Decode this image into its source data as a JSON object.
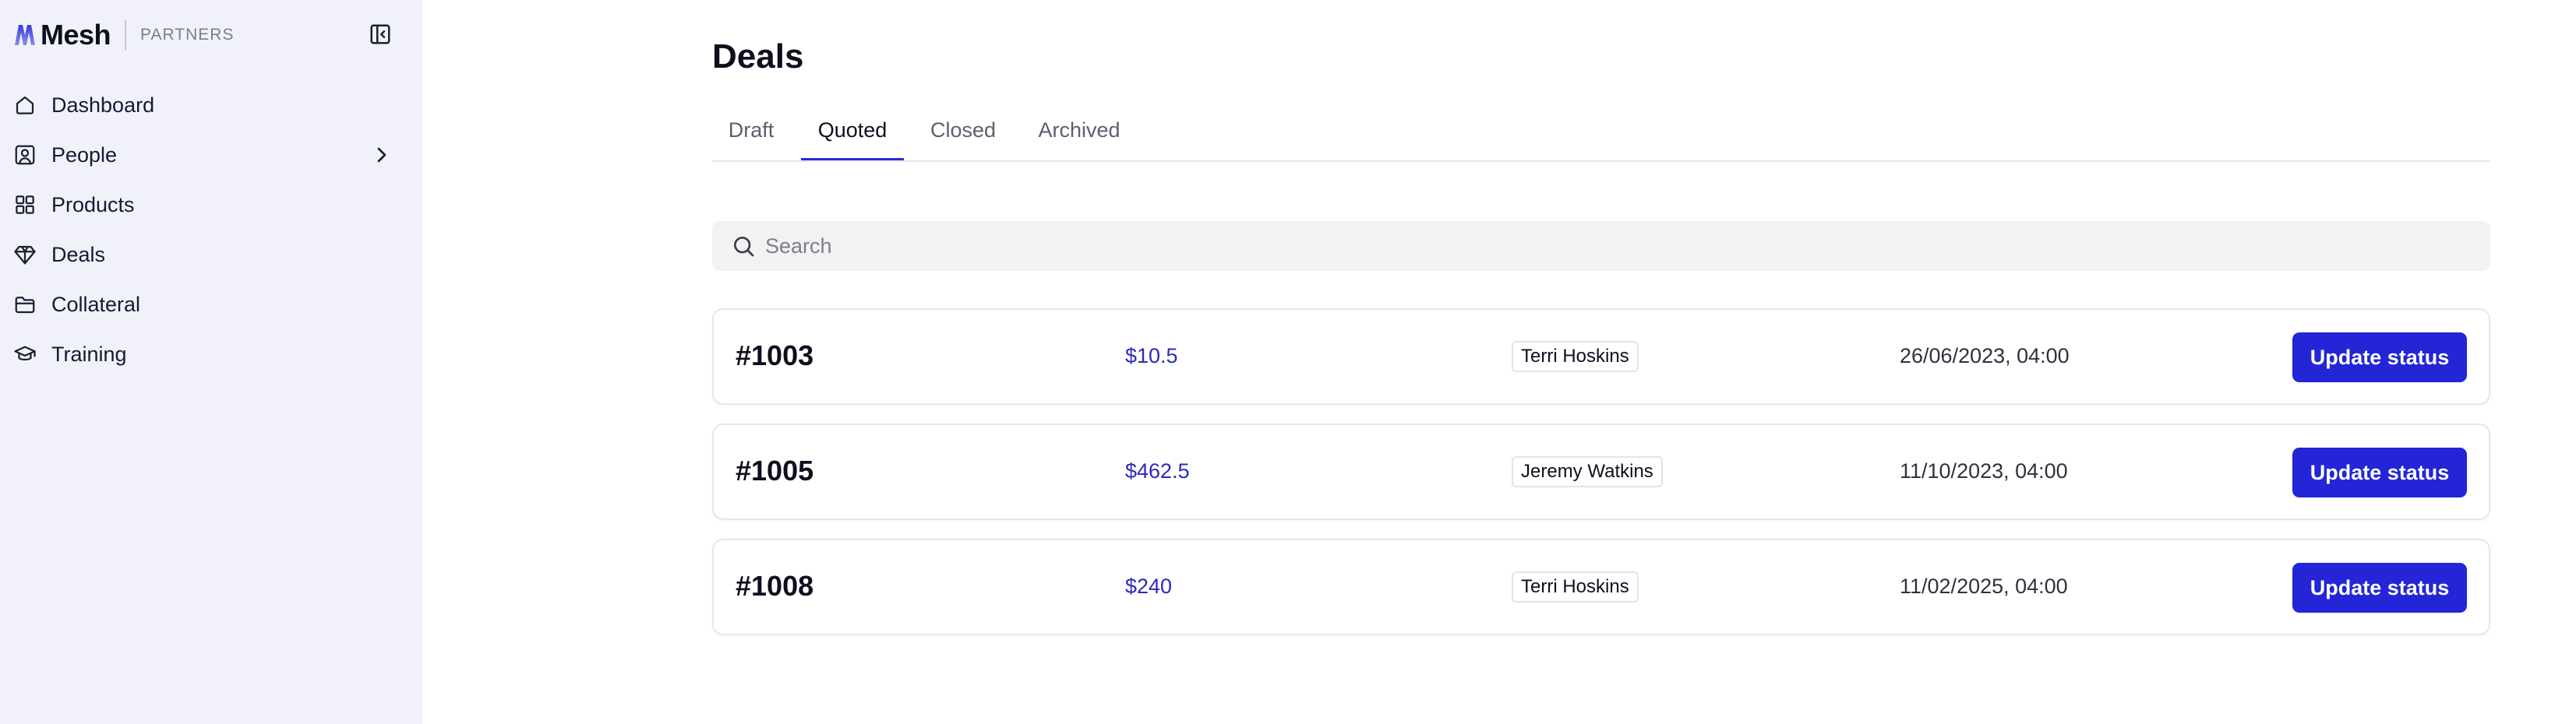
{
  "brand": {
    "name": "Mesh",
    "subtitle": "PARTNERS"
  },
  "sidebar": {
    "collapse_icon": "sidebar-collapse-icon",
    "items": [
      {
        "label": "Dashboard",
        "icon": "home-icon"
      },
      {
        "label": "People",
        "icon": "user-square-icon",
        "has_submenu": true
      },
      {
        "label": "Products",
        "icon": "grid-icon"
      },
      {
        "label": "Deals",
        "icon": "diamond-icon"
      },
      {
        "label": "Collateral",
        "icon": "folder-icon"
      },
      {
        "label": "Training",
        "icon": "graduation-cap-icon"
      }
    ]
  },
  "main": {
    "title": "Deals",
    "tabs": [
      {
        "label": "Draft",
        "active": false
      },
      {
        "label": "Quoted",
        "active": true
      },
      {
        "label": "Closed",
        "active": false
      },
      {
        "label": "Archived",
        "active": false
      }
    ],
    "search": {
      "placeholder": "Search",
      "value": ""
    },
    "deals": [
      {
        "id": "#1003",
        "amount": "$10.5",
        "person": "Terri Hoskins",
        "date": "26/06/2023, 04:00",
        "action": "Update status"
      },
      {
        "id": "#1005",
        "amount": "$462.5",
        "person": "Jeremy Watkins",
        "date": "11/10/2023, 04:00",
        "action": "Update status"
      },
      {
        "id": "#1008",
        "amount": "$240",
        "person": "Terri Hoskins",
        "date": "11/02/2025, 04:00",
        "action": "Update status"
      }
    ]
  },
  "colors": {
    "sidebar_bg": "#f1f2f9",
    "accent": "#2325d6",
    "amount_text": "#2a2bb8",
    "tab_underline": "#2a2bd8"
  }
}
